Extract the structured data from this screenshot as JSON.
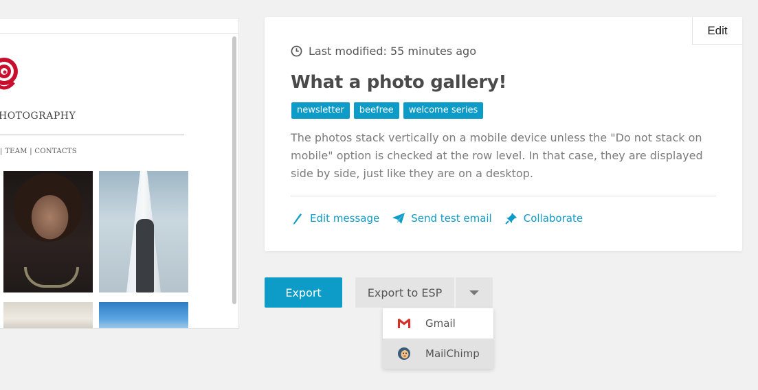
{
  "preview": {
    "brand": "HOTOGRAPHY",
    "menu": "| TEAM  |  CONTACTS"
  },
  "card": {
    "edit_label": "Edit",
    "last_modified": "Last modified: 55 minutes ago",
    "title": "What a photo gallery!",
    "tags": [
      "newsletter",
      "beefree",
      "welcome series"
    ],
    "description": "The photos stack vertically on a mobile device unless the \"Do not stack on mobile\" option is checked at the row level. In that case, they are displayed side by side, just like they are on a desktop.",
    "actions": {
      "edit_message": "Edit message",
      "send_test": "Send test email",
      "collaborate": "Collaborate"
    }
  },
  "export": {
    "export_label": "Export",
    "esp_label": "Export to ESP",
    "options": [
      {
        "label": "Gmail",
        "icon": "gmail-icon"
      },
      {
        "label": "MailChimp",
        "icon": "mailchimp-icon"
      }
    ]
  },
  "colors": {
    "accent": "#0d9bc8",
    "background": "#f1f1f1",
    "rose": "#c8102e"
  }
}
